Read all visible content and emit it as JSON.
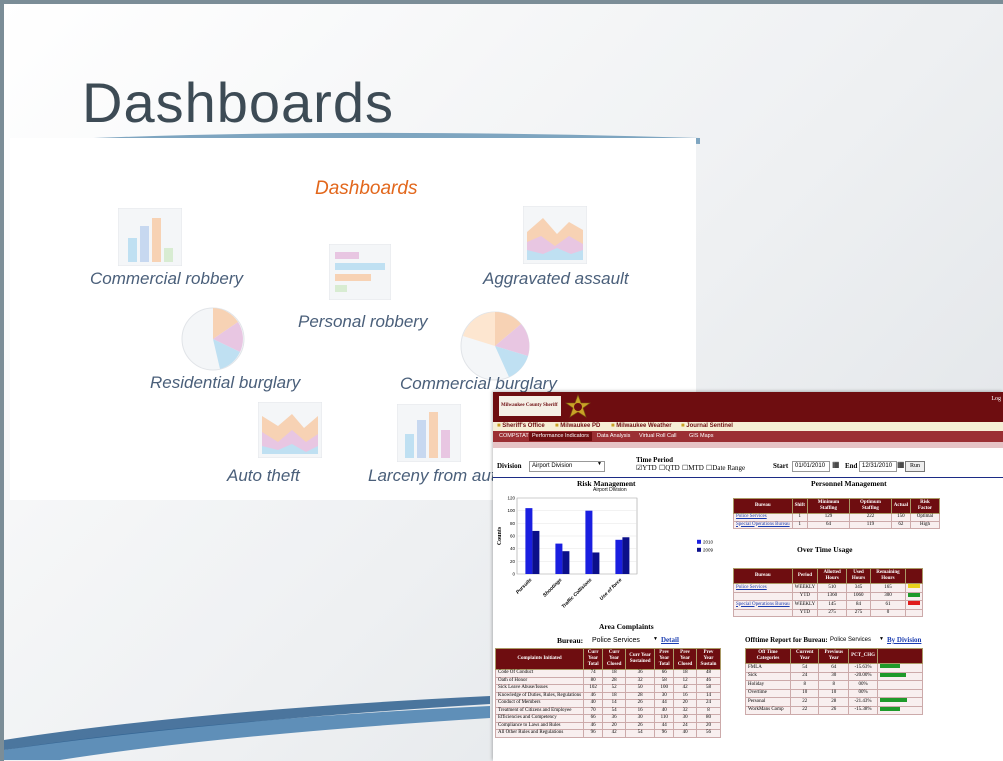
{
  "slide": {
    "title": "Dashboards",
    "panel_heading": "Dashboards",
    "dashboard_items": [
      {
        "label": "Commercial robbery",
        "icon": "bar-chart-icon"
      },
      {
        "label": "Personal robbery",
        "icon": "horizontal-bar-icon"
      },
      {
        "label": "Aggravated assault",
        "icon": "area-chart-icon"
      },
      {
        "label": "Residential burglary",
        "icon": "pie-chart-icon"
      },
      {
        "label": "Commercial burglary",
        "icon": "pie-chart-icon"
      },
      {
        "label": "Auto theft",
        "icon": "area-chart-icon"
      },
      {
        "label": "Larceny from auto",
        "icon": "bar-chart-icon"
      }
    ]
  },
  "screenshot": {
    "logo_text": "Milwaukee County Sheriff",
    "login_label": "Log",
    "links": [
      "Sheriff's Office",
      "Milwaukee PD",
      "Milwaukee Weather",
      "Journal Sentinel"
    ],
    "tabs": [
      "COMPSTAT",
      "Performance Indicators",
      "Data Analysis",
      "Virtual Roll Call",
      "GIS Maps"
    ],
    "filters": {
      "division_label": "Division",
      "division_value": "Airport Division",
      "time_period_label": "Time Period",
      "options": [
        "YTD",
        "QTD",
        "MTD",
        "Date Range"
      ],
      "start_label": "Start",
      "start_value": "01/01/2010",
      "end_label": "End",
      "end_value": "12/31/2010",
      "run_label": "Run"
    },
    "risk_title": "Risk Management",
    "risk_subtitle": "Airport Division",
    "personnel_title": "Personnel Management",
    "overtime_title": "Over Time Usage",
    "area_title": "Area Complaints",
    "bureau_label": "Bureau:",
    "bureau_value": "Police Services",
    "detail_label": "Detail",
    "offtime_label": "Offtime Report for Bureau:",
    "offtime_value": "Police Services",
    "by_division_label": "By Division",
    "personnel_table": {
      "headers": [
        "Bureau",
        "Shift",
        "Minimum Staffing",
        "Optimum Staffing",
        "Actual",
        "Risk Factor"
      ],
      "rows": [
        [
          "Police Services",
          "1",
          "129",
          "222",
          "150",
          "Optimal"
        ],
        [
          "Special Operations Bureau",
          "1",
          "64",
          "119",
          "62",
          "High"
        ]
      ]
    },
    "overtime_table": {
      "headers": [
        "Bureau",
        "Period",
        "Allotted Hours",
        "Used Hours",
        "Remaining Hours"
      ],
      "rows": [
        [
          "Police Services",
          "WEEKLY",
          "510",
          "345",
          "165",
          "#e8d21d"
        ],
        [
          "",
          "YTD",
          "1360",
          "1060",
          "300",
          "#1e9a2a"
        ],
        [
          "Special Operations Bureau",
          "WEEKLY",
          "145",
          "84",
          "61",
          "#e01b1b"
        ],
        [
          "",
          "YTD",
          "275",
          "275",
          "0",
          ""
        ]
      ]
    },
    "complaints_table": {
      "headers": [
        "Complaints Initiated",
        "Curr Year Total",
        "Curr Year Closed",
        "Curr Year Sustained",
        "Prev Year Total",
        "Prev Year Closed",
        "Prev Year Sustain"
      ],
      "rows": [
        [
          "Code Of Conduct",
          "74",
          "18",
          "36",
          "66",
          "18",
          "48"
        ],
        [
          "Oath of Honor",
          "80",
          "28",
          "32",
          "58",
          "12",
          "46"
        ],
        [
          "Sick Leave Abuse/Issues",
          "102",
          "52",
          "50",
          "100",
          "42",
          "58"
        ],
        [
          "Knowledge of Duties, Rules, Regulations",
          "46",
          "18",
          "28",
          "30",
          "16",
          "14"
        ],
        [
          "Conduct of Members",
          "40",
          "14",
          "26",
          "44",
          "20",
          "24"
        ],
        [
          "Treatment of Citizens and Employee",
          "70",
          "54",
          "16",
          "40",
          "32",
          "8"
        ],
        [
          "Efficiencies and Competency",
          "66",
          "36",
          "30",
          "110",
          "30",
          "80"
        ],
        [
          "Compliance to Laws and Rules",
          "46",
          "20",
          "26",
          "44",
          "24",
          "20"
        ],
        [
          "All Other Rules and Regulations",
          "96",
          "42",
          "54",
          "96",
          "40",
          "56"
        ]
      ]
    },
    "offtime_table": {
      "headers": [
        "Off Time Categories",
        "Current Year",
        "Previous Year",
        "PCT_CHG"
      ],
      "rows": [
        [
          "FMLA",
          "54",
          "64",
          "-15.63%",
          0.5
        ],
        [
          "Sick",
          "24",
          "30",
          "-20.00%",
          0.64
        ],
        [
          "Holiday",
          "8",
          "8",
          "00%",
          0
        ],
        [
          "Overtime",
          "10",
          "10",
          "00%",
          0
        ],
        [
          "Personal",
          "22",
          "28",
          "-21.43%",
          0.68
        ],
        [
          "WorkMans Comp",
          "22",
          "26",
          "-15.38%",
          0.49
        ]
      ]
    }
  },
  "chart_data": {
    "type": "bar",
    "title": "Risk Management",
    "subtitle": "Airport Division",
    "ylabel": "Counts",
    "ylim": [
      0,
      120
    ],
    "yticks": [
      0,
      20,
      40,
      60,
      80,
      100,
      120
    ],
    "categories": [
      "Pursuits",
      "Shootings",
      "Traffic Collisions",
      "Use of force"
    ],
    "series": [
      {
        "name": "2010",
        "values": [
          104,
          48,
          100,
          54
        ],
        "color": "#1a1fe0"
      },
      {
        "name": "2009",
        "values": [
          68,
          36,
          34,
          58
        ],
        "color": "#0b0f8a"
      }
    ],
    "legend": "right"
  }
}
